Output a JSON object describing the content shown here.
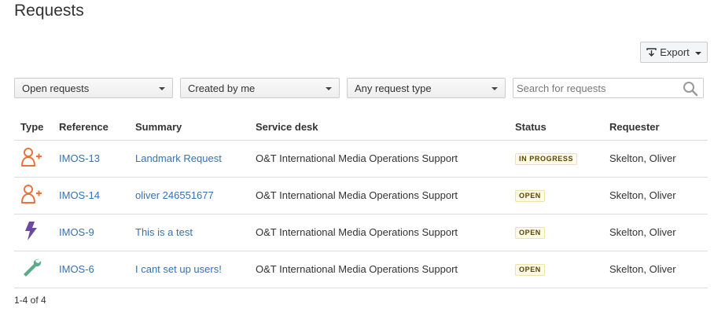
{
  "page": {
    "title": "Requests"
  },
  "toolbar": {
    "export_label": "Export"
  },
  "filters": {
    "status": "Open requests",
    "creator": "Created by me",
    "request_type": "Any request type",
    "search_placeholder": "Search for requests"
  },
  "table": {
    "headers": {
      "type": "Type",
      "reference": "Reference",
      "summary": "Summary",
      "service_desk": "Service desk",
      "status": "Status",
      "requester": "Requester"
    },
    "rows": [
      {
        "type_icon": "add-user-icon",
        "reference": "IMOS-13",
        "summary": "Landmark Request",
        "service_desk": "O&T International Media Operations Support",
        "status": "IN PROGRESS",
        "requester": "Skelton, Oliver"
      },
      {
        "type_icon": "add-user-icon",
        "reference": "IMOS-14",
        "summary": "oliver 246551677",
        "service_desk": "O&T International Media Operations Support",
        "status": "OPEN",
        "requester": "Skelton, Oliver"
      },
      {
        "type_icon": "lightning-bolt-icon",
        "reference": "IMOS-9",
        "summary": "This is a test",
        "service_desk": "O&T International Media Operations Support",
        "status": "OPEN",
        "requester": "Skelton, Oliver"
      },
      {
        "type_icon": "wrench-icon",
        "reference": "IMOS-6",
        "summary": "I cant set up users!",
        "service_desk": "O&T International Media Operations Support",
        "status": "OPEN",
        "requester": "Skelton, Oliver"
      }
    ]
  },
  "pagination": {
    "label": "1-4 of 4"
  },
  "colors": {
    "link": "#3572b0",
    "add_user_icon": "#e8743b",
    "lightning_icon": "#6b4aa0",
    "wrench_icon": "#5aab8a",
    "lozenge_bg": "#fffbe6"
  }
}
